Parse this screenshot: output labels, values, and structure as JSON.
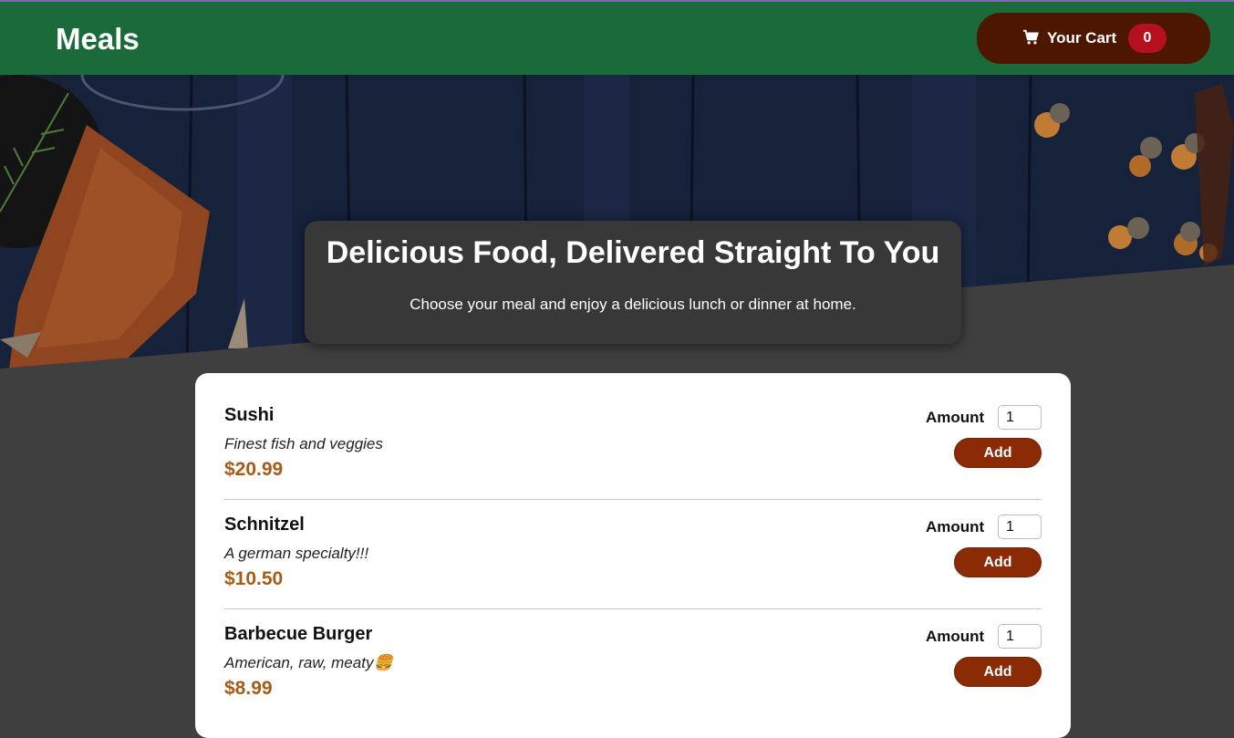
{
  "header": {
    "brand": "Meals",
    "cart_label": "Your Cart",
    "cart_count": "0"
  },
  "summary": {
    "title": "Delicious Food, Delivered Straight To You",
    "text": "Choose your meal and enjoy a delicious lunch or dinner at home."
  },
  "meals": [
    {
      "name": "Sushi",
      "description": "Finest fish and veggies",
      "price": "$20.99",
      "amount_label": "Amount",
      "amount_value": "1",
      "add_label": "Add"
    },
    {
      "name": "Schnitzel",
      "description": "A german specialty!!!",
      "price": "$10.50",
      "amount_label": "Amount",
      "amount_value": "1",
      "add_label": "Add"
    },
    {
      "name": "Barbecue Burger",
      "description": "American, raw, meaty🍔",
      "price": "$8.99",
      "amount_label": "Amount",
      "amount_value": "1",
      "add_label": "Add"
    }
  ],
  "colors": {
    "header_bg": "#1a6b39",
    "cart_button_bg": "#4d1601",
    "badge_bg": "#b5101e",
    "price": "#a65b16",
    "add_button_bg": "#8a2b06"
  }
}
